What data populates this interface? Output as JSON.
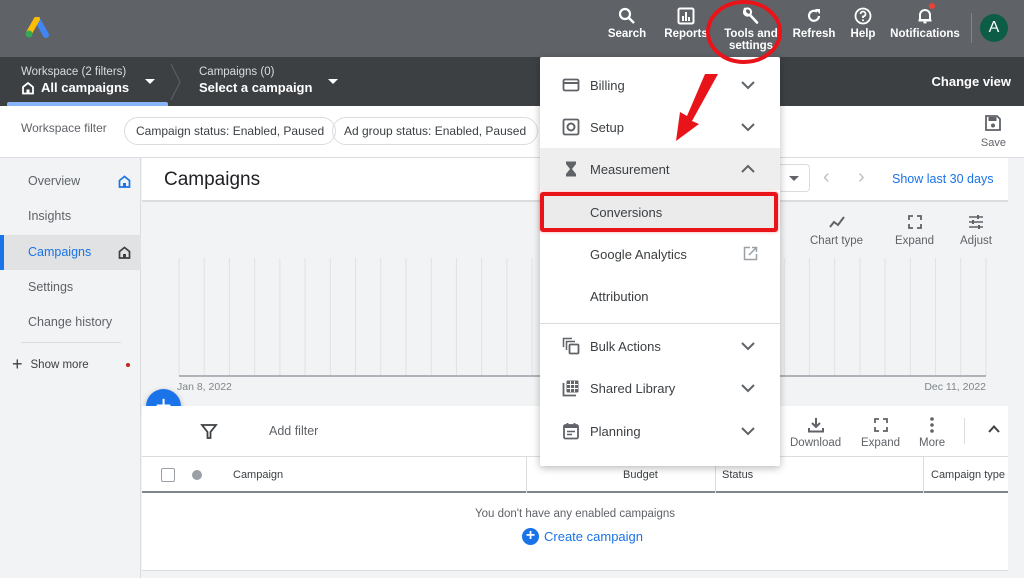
{
  "topbar": {
    "logo": "google-ads-logo",
    "actions": [
      {
        "label": "Search",
        "icon": "search-icon"
      },
      {
        "label": "Reports",
        "icon": "reports-icon"
      },
      {
        "label": "Tools and settings",
        "icon": "wrench-icon"
      },
      {
        "label": "Refresh",
        "icon": "refresh-icon"
      },
      {
        "label": "Help",
        "icon": "help-icon"
      },
      {
        "label": "Notifications",
        "icon": "bell-icon"
      }
    ],
    "avatar_letter": "A"
  },
  "crumbs": {
    "workspace_small": "Workspace (2 filters)",
    "workspace_big": "All campaigns",
    "campaigns_small": "Campaigns (0)",
    "campaigns_big": "Select a campaign",
    "change_view": "Change view"
  },
  "filterbar": {
    "label": "Workspace filter",
    "chips": [
      "Campaign status: Enabled, Paused",
      "Ad group status: Enabled, Paused"
    ],
    "save_label": "Save"
  },
  "sidebar": {
    "items": [
      {
        "label": "Overview",
        "has_home_icon": true
      },
      {
        "label": "Insights"
      },
      {
        "label": "Campaigns",
        "active": true,
        "has_home_icon": true
      },
      {
        "label": "Settings"
      },
      {
        "label": "Change history"
      }
    ],
    "show_more": "Show more"
  },
  "main": {
    "title": "Campaigns",
    "show_last": "Show last 30 days",
    "chart_tools": [
      "Chart type",
      "Expand",
      "Adjust"
    ],
    "x_start": "Jan 8, 2022",
    "x_end": "Dec 11, 2022",
    "add_filter": "Add filter",
    "table_tools": [
      "Download",
      "Expand",
      "More"
    ],
    "columns": [
      "Campaign",
      "Budget",
      "Status",
      "Campaign type"
    ],
    "empty_message": "You don't have any enabled campaigns",
    "create_campaign": "Create campaign"
  },
  "menu": {
    "sections": [
      {
        "label": "Billing",
        "icon": "credit-card-icon",
        "state": "collapsed"
      },
      {
        "label": "Setup",
        "icon": "setup-icon",
        "state": "collapsed"
      },
      {
        "label": "Measurement",
        "icon": "hourglass-icon",
        "state": "expanded"
      }
    ],
    "measurement_items": [
      {
        "label": "Conversions",
        "highlighted": true
      },
      {
        "label": "Google Analytics",
        "external": true
      },
      {
        "label": "Attribution"
      }
    ],
    "more_sections": [
      {
        "label": "Bulk Actions",
        "icon": "bulk-actions-icon"
      },
      {
        "label": "Shared Library",
        "icon": "shared-library-icon"
      },
      {
        "label": "Planning",
        "icon": "planning-icon"
      }
    ]
  },
  "colors": {
    "accent": "#1a73e8",
    "annotation_red": "#e8141a",
    "topbar": "#5f6368",
    "crumbbar": "#3c4043"
  }
}
